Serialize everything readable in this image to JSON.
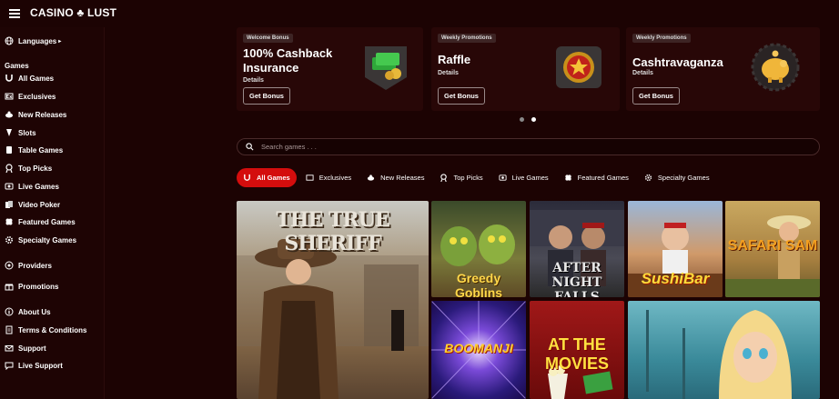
{
  "brand": {
    "logo_text": "CASINO ♣ LUST"
  },
  "sidebar": {
    "languages_label": "Languages",
    "games_heading": "Games",
    "items": [
      {
        "label": "All Games",
        "icon": "horseshoe-icon"
      },
      {
        "label": "Exclusives",
        "icon": "exclusive-icon"
      },
      {
        "label": "New Releases",
        "icon": "new-icon"
      },
      {
        "label": "Slots",
        "icon": "slot-icon"
      },
      {
        "label": "Table Games",
        "icon": "cards-icon"
      },
      {
        "label": "Top Picks",
        "icon": "trophy-icon"
      },
      {
        "label": "Live Games",
        "icon": "live-icon"
      },
      {
        "label": "Video Poker",
        "icon": "poker-icon"
      },
      {
        "label": "Featured Games",
        "icon": "clover-icon"
      },
      {
        "label": "Specialty Games",
        "icon": "gear-icon"
      }
    ],
    "providers_label": "Providers",
    "promotions_label": "Promotions",
    "footer_items": [
      {
        "label": "About Us",
        "icon": "info-icon"
      },
      {
        "label": "Terms & Conditions",
        "icon": "document-icon"
      },
      {
        "label": "Support",
        "icon": "mail-icon"
      },
      {
        "label": "Live Support",
        "icon": "chat-icon"
      }
    ]
  },
  "promos": [
    {
      "tag": "Welcome Bonus",
      "title": "100% Cashback Insurance",
      "details": "Details",
      "button": "Get Bonus",
      "art": "cash-stack-icon"
    },
    {
      "tag": "Weekly Promotions",
      "title": "Raffle",
      "details": "Details",
      "button": "Get Bonus",
      "art": "star-medal-icon"
    },
    {
      "tag": "Weekly Promotions",
      "title": "Cashtravaganza",
      "details": "Details",
      "button": "Get Bonus",
      "art": "piggy-bank-icon"
    }
  ],
  "carousel": {
    "pages": 2,
    "active": 2
  },
  "search": {
    "placeholder": "Search games . . ."
  },
  "tabs": [
    {
      "label": "All Games",
      "icon": "horseshoe-icon",
      "active": true
    },
    {
      "label": "Exclusives",
      "icon": "exclusive-icon",
      "active": false
    },
    {
      "label": "New Releases",
      "icon": "new-icon",
      "active": false
    },
    {
      "label": "Top Picks",
      "icon": "trophy-icon",
      "active": false
    },
    {
      "label": "Live Games",
      "icon": "live-icon",
      "active": false
    },
    {
      "label": "Featured Games",
      "icon": "clover-icon",
      "active": false
    },
    {
      "label": "Specialty Games",
      "icon": "gear-icon",
      "active": false
    }
  ],
  "games": [
    {
      "title": "THE TRUE SHERIFF"
    },
    {
      "title": "Greedy Goblins"
    },
    {
      "title": "AFTER NIGHT FALLS"
    },
    {
      "title": "SushiBar"
    },
    {
      "title": "SAFARI SAM"
    },
    {
      "title": "BOOMANJI"
    },
    {
      "title": "AT THE MOVIES"
    },
    {
      "title": ""
    }
  ],
  "colors": {
    "background": "#1c0303",
    "accent": "#d40d0d",
    "card": "#280707"
  }
}
